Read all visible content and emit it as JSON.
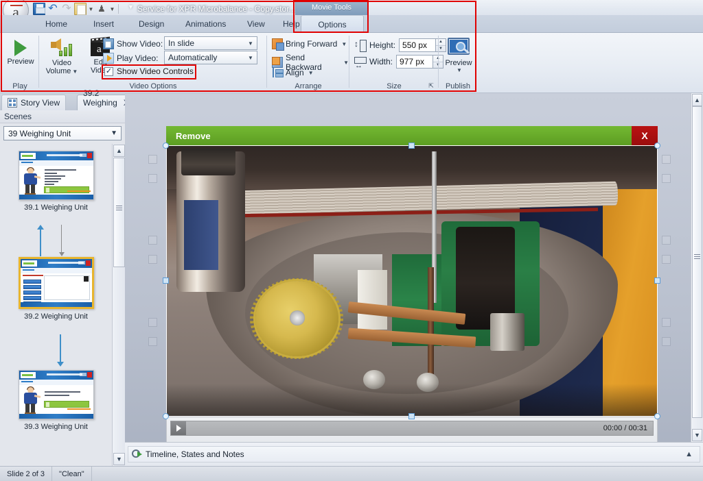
{
  "window": {
    "title": "Service for XPR Microbalance - Copy.stor...",
    "quick_access": [
      {
        "name": "save-icon",
        "label": "Save"
      },
      {
        "name": "undo-icon",
        "label": "Undo"
      },
      {
        "name": "redo-icon",
        "label": "Redo"
      },
      {
        "name": "paste-icon",
        "label": "Paste"
      },
      {
        "name": "format-painter-icon",
        "label": "Format Painter"
      }
    ]
  },
  "ribbon": {
    "contextual_group": "Movie Tools",
    "tabs": [
      {
        "label": "Home",
        "active": false
      },
      {
        "label": "Insert",
        "active": false
      },
      {
        "label": "Design",
        "active": false
      },
      {
        "label": "Animations",
        "active": false
      },
      {
        "label": "View",
        "active": false
      },
      {
        "label": "Help",
        "active": false
      },
      {
        "label": "Options",
        "active": true
      }
    ],
    "groups": {
      "play": {
        "label": "Play",
        "preview_button": "Preview"
      },
      "video_options": {
        "label": "Video Options",
        "video_volume": "Video\nVolume",
        "video_volume_line1": "Video",
        "video_volume_line2": "Volume",
        "edit_video_line1": "Edit",
        "edit_video_line2": "Video",
        "show_video_label": "Show Video:",
        "show_video_value": "In slide",
        "play_video_label": "Play Video:",
        "play_video_value": "Automatically",
        "show_video_controls_label": "Show Video Controls",
        "show_video_controls_checked": true
      },
      "arrange": {
        "label": "Arrange",
        "bring_forward": "Bring Forward",
        "send_backward": "Send Backward",
        "align": "Align"
      },
      "size": {
        "label": "Size",
        "height_label": "Height:",
        "height_value": "550 px",
        "width_label": "Width:",
        "width_value": "977 px"
      },
      "publish": {
        "label": "Publish",
        "preview_button": "Preview"
      }
    }
  },
  "left_panel": {
    "view_tabs": [
      {
        "label": "Story View",
        "active": false,
        "closable": false
      },
      {
        "label": "39.2 Weighing ...",
        "active": true,
        "closable": true,
        "close_label": "X"
      }
    ],
    "scenes_header": "Scenes",
    "scene_selected": "39 Weighing Unit",
    "slides": [
      {
        "caption": "39.1 Weighing Unit",
        "selected": false
      },
      {
        "caption": "39.2 Weighing Unit",
        "selected": true
      },
      {
        "caption": "39.3 Weighing Unit",
        "selected": false
      }
    ]
  },
  "canvas": {
    "video_object": {
      "title": "Remove",
      "close_label": "X",
      "controls": {
        "play_label": "Play",
        "time": "00:00 / 00:31"
      }
    }
  },
  "timeline": {
    "label": "Timeline, States and Notes",
    "collapse_icon": "chevron-up-icon"
  },
  "status_bar": {
    "slide_counter": "Slide 2 of 3",
    "theme": "\"Clean\""
  },
  "colors": {
    "annotation_red": "#e00000",
    "video_title_green": "#68ab2a",
    "video_close_red": "#b91212",
    "selection_blue": "#5b9bd5",
    "selected_slide_gold": "#e8b52e"
  }
}
